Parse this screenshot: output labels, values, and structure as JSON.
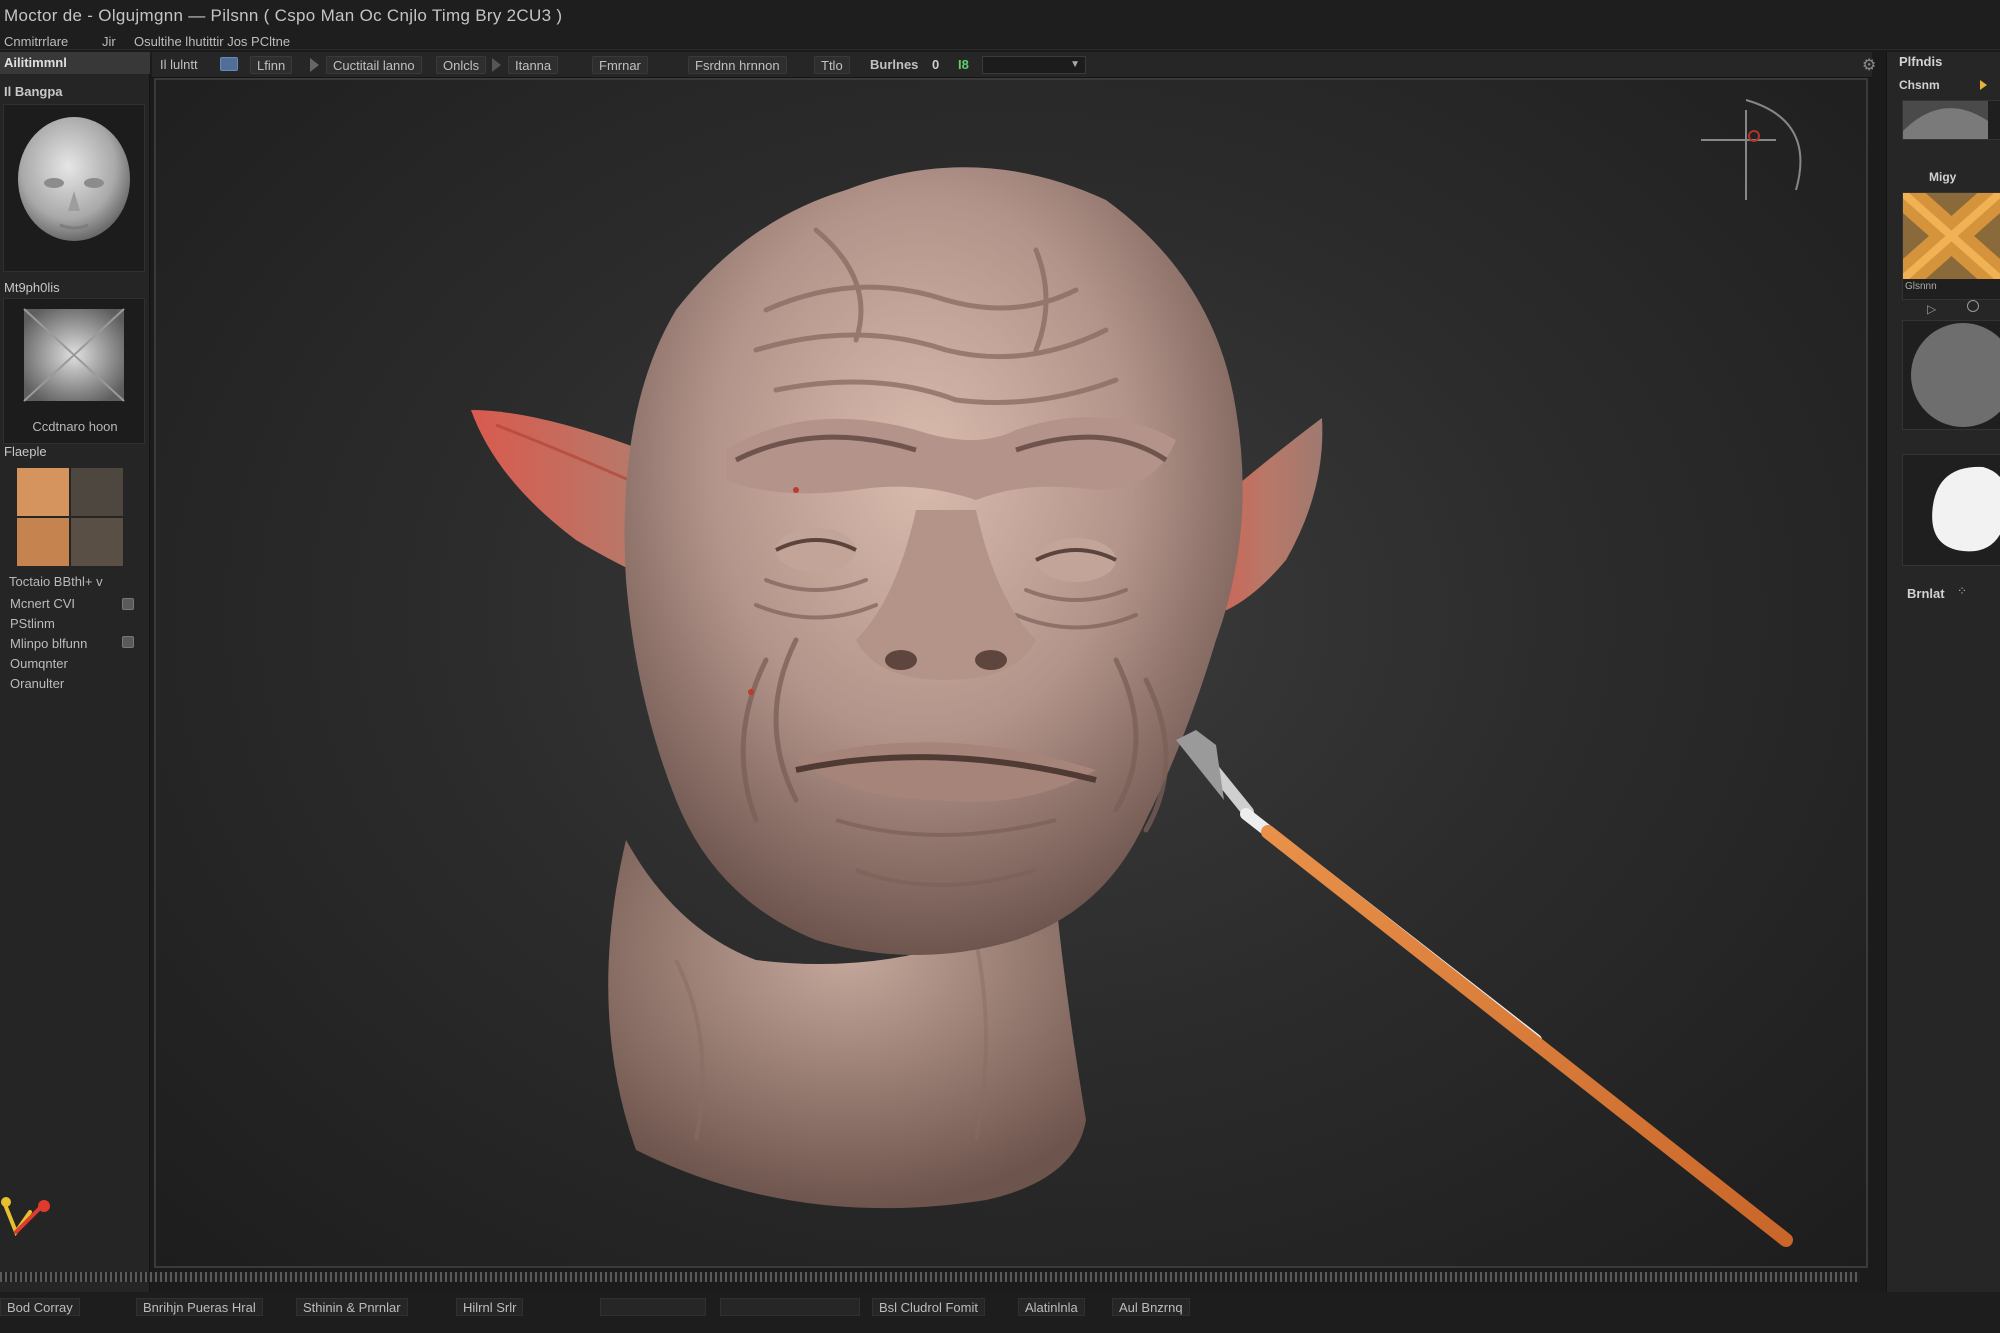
{
  "window": {
    "title": "Moctor de - Olgujmgnn — Pilsnn ( Cspo Man Oc Cnjlo Timg Bry 2CU3 )"
  },
  "menu": {
    "items": [
      "Cnmitrrlare",
      "Jir",
      "Osultihe lhutittir Jos PCltne"
    ]
  },
  "left_panel": {
    "header": "Ailitimmnl",
    "section1_title": "Il Bangpa",
    "section2_title": "Mt9ph0lis",
    "section2_caption": "Ccdtnaro hoon",
    "section3_title": "Flaeple",
    "texture_label": "Toctaio BBthl+ v",
    "props": [
      "Mcnert CVI",
      "PStlinm",
      "Mlinpo blfunn",
      "Oumqnter",
      "Oranulter"
    ]
  },
  "toolbar": {
    "items": [
      "Il lulntt",
      "Lfinn",
      "Cuctitail lanno",
      "Onlcls",
      "Itanna",
      "Fmrnar",
      "Fsrdnn hrnnon",
      "Ttlo",
      "Burlnes"
    ],
    "zero_value": "0",
    "green_value": "I8",
    "accent_color": "#4f6f97"
  },
  "statusbar": {
    "items": [
      "Bod Corray",
      "Bnrihjn Pueras Hral",
      "Sthinin & Pnrnlar",
      "Hilrnl Srlr",
      "Bsl Cludrol Fomit",
      "Alatinlnla",
      "Aul Bnzrnq"
    ]
  },
  "right_panel": {
    "title": "Plfndis",
    "sub1": "Chsnm",
    "sub2": "Migy",
    "thumb_caption": "Glsnnn",
    "bottom_label": "Brnlat",
    "accent_color": "#d5943b"
  }
}
